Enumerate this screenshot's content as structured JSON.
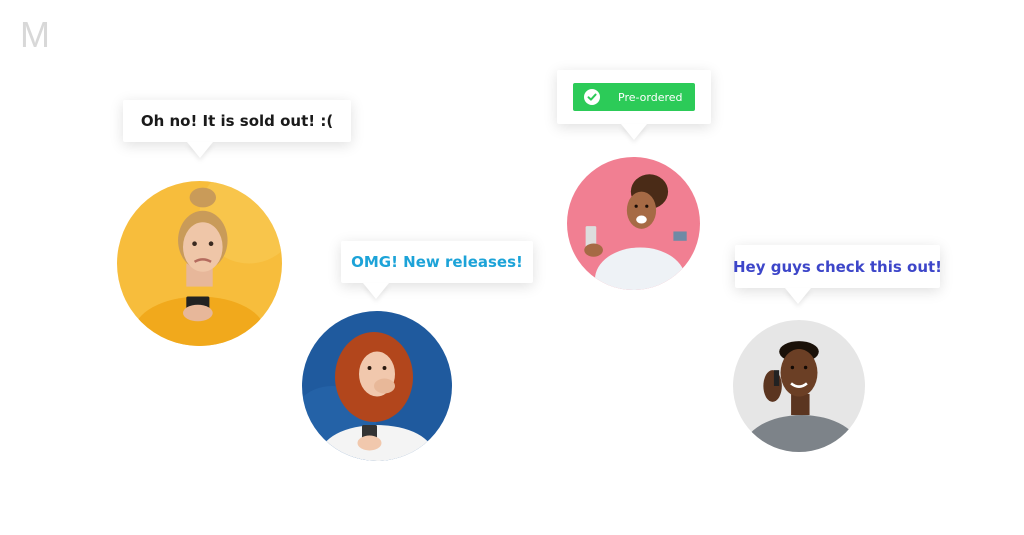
{
  "logo": {
    "letter": "M",
    "color": "#d8d8d8"
  },
  "bubbles": {
    "sold_out": {
      "text": "Oh no! It is sold out! :(",
      "color": "#1a1a1a"
    },
    "new_releases": {
      "text": "OMG! New releases!",
      "color": "#1ca3d8"
    },
    "preordered": {
      "text": "Pre-ordered",
      "bg": "#2ccb58"
    },
    "check_this": {
      "text": "Hey guys check this out!",
      "color": "#3d46c9"
    }
  },
  "avatars": {
    "sad_woman": {
      "bg": "#f7bd3c"
    },
    "surprised_woman": {
      "bg": "#1f5a9e"
    },
    "excited_woman": {
      "bg": "#f17f92"
    },
    "smiling_man": {
      "bg": "#e6e6e6"
    }
  }
}
